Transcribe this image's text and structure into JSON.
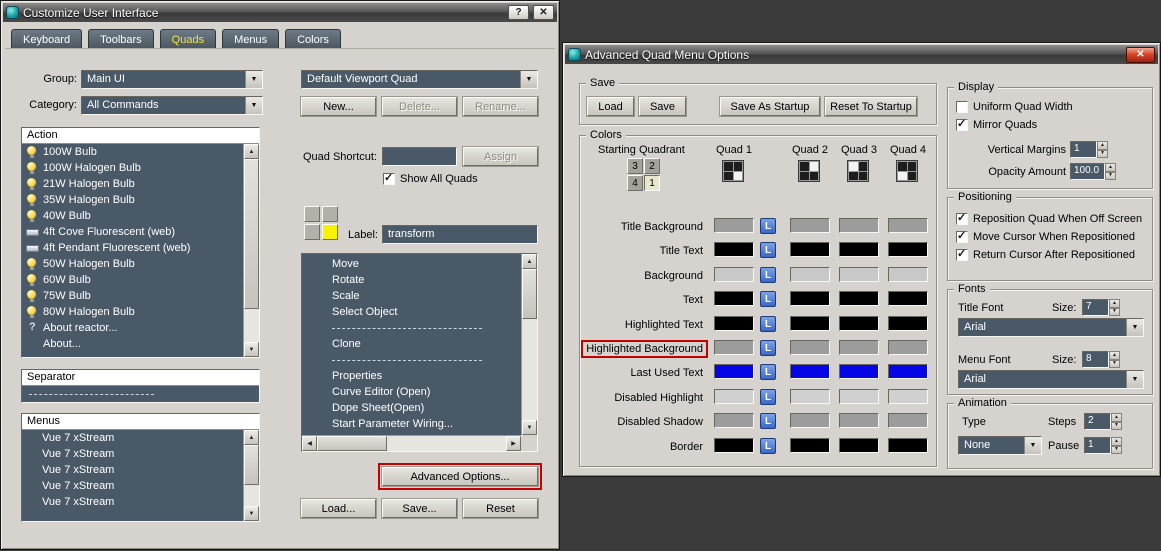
{
  "icons": {
    "help": "?",
    "close": "✕",
    "check": "✓",
    "up_arrow": "▲",
    "down_arrow": "▼",
    "left_arrow": "◀",
    "right_arrow": "▶"
  },
  "customize_window": {
    "title": "Customize User Interface",
    "tabs": [
      {
        "label": "Keyboard",
        "active": false
      },
      {
        "label": "Toolbars",
        "active": false
      },
      {
        "label": "Quads",
        "active": true
      },
      {
        "label": "Menus",
        "active": false
      },
      {
        "label": "Colors",
        "active": false
      }
    ],
    "group": {
      "label": "Group:",
      "value": "Main UI"
    },
    "category": {
      "label": "Category:",
      "value": "All Commands"
    },
    "action_list": {
      "header": "Action",
      "items": [
        {
          "label": "100W Bulb",
          "icon": "bulb"
        },
        {
          "label": "100W Halogen Bulb",
          "icon": "bulb"
        },
        {
          "label": "21W Halogen Bulb",
          "icon": "bulb"
        },
        {
          "label": "35W Halogen Bulb",
          "icon": "bulb"
        },
        {
          "label": "40W Bulb",
          "icon": "bulb"
        },
        {
          "label": "4ft Cove Fluorescent (web)",
          "icon": "fluorescent"
        },
        {
          "label": "4ft Pendant Fluorescent (web)",
          "icon": "fluorescent"
        },
        {
          "label": "50W Halogen Bulb",
          "icon": "bulb"
        },
        {
          "label": "60W Bulb",
          "icon": "bulb"
        },
        {
          "label": "75W Bulb",
          "icon": "bulb"
        },
        {
          "label": "80W Halogen Bulb",
          "icon": "bulb"
        },
        {
          "label": "About reactor...",
          "icon": "question"
        },
        {
          "label": "About...",
          "icon": "none"
        }
      ]
    },
    "separator_list": {
      "header": "Separator"
    },
    "menus_list": {
      "header": "Menus",
      "items": [
        "Vue 7 xStream",
        "Vue 7 xStream",
        "Vue 7 xStream",
        "Vue 7 xStream",
        "Vue 7 xStream"
      ]
    },
    "viewport_quad_select": {
      "value": "Default Viewport Quad"
    },
    "new_button": "New...",
    "delete_button": "Delete...",
    "rename_button": "Rename...",
    "quad_shortcut_label": "Quad Shortcut:",
    "quad_shortcut_value": "",
    "assign_button": "Assign",
    "show_all_quads": {
      "label": "Show All Quads",
      "checked": true
    },
    "quad_cells": [
      false,
      false,
      false,
      true
    ],
    "label_field": {
      "label": "Label:",
      "value": "transform"
    },
    "quad_menu_items": [
      {
        "label": "Move",
        "type": "item"
      },
      {
        "label": "Rotate",
        "type": "item"
      },
      {
        "label": "Scale",
        "type": "item"
      },
      {
        "label": "Select Object",
        "type": "item"
      },
      {
        "label": "",
        "type": "separator"
      },
      {
        "label": "Clone",
        "type": "item"
      },
      {
        "label": "",
        "type": "separator"
      },
      {
        "label": "Properties",
        "type": "item"
      },
      {
        "label": "Curve Editor (Open)",
        "type": "item"
      },
      {
        "label": "Dope Sheet(Open)",
        "type": "item"
      },
      {
        "label": "Start Parameter Wiring...",
        "type": "item"
      }
    ],
    "advanced_options_button": "Advanced Options...",
    "load_button": "Load...",
    "save_button": "Save...",
    "reset_button": "Reset"
  },
  "advanced_dialog": {
    "title": "Advanced Quad Menu Options",
    "save_group": {
      "label": "Save",
      "load": "Load",
      "save": "Save",
      "save_as_startup": "Save As Startup",
      "reset_to_startup": "Reset To Startup"
    },
    "colors_group": {
      "label": "Colors",
      "starting_quadrant_label": "Starting Quadrant",
      "quadrant_cells": [
        {
          "label": "3",
          "active": false
        },
        {
          "label": "2",
          "active": false
        },
        {
          "label": "4",
          "active": false
        },
        {
          "label": "1",
          "active": true
        }
      ],
      "quad_columns": [
        "Quad 1",
        "Quad 2",
        "Quad 3",
        "Quad 4"
      ],
      "lock_button": "L",
      "rows": [
        {
          "label": "Title Background",
          "color": "#9c9c9c",
          "highlighted": false
        },
        {
          "label": "Title Text",
          "color": "#000000",
          "highlighted": false
        },
        {
          "label": "Background",
          "color": "#c8c8c8",
          "highlighted": false
        },
        {
          "label": "Text",
          "color": "#000000",
          "highlighted": false
        },
        {
          "label": "Highlighted Text",
          "color": "#000000",
          "highlighted": false
        },
        {
          "label": "Highlighted Background",
          "color": "#9c9c9c",
          "highlighted": true
        },
        {
          "label": "Last Used Text",
          "color": "#0505e6",
          "highlighted": false
        },
        {
          "label": "Disabled Highlight",
          "color": "#d0d0d0",
          "highlighted": false
        },
        {
          "label": "Disabled Shadow",
          "color": "#9c9c9c",
          "highlighted": false
        },
        {
          "label": "Border",
          "color": "#000000",
          "highlighted": false
        }
      ]
    },
    "display_group": {
      "label": "Display",
      "uniform_quad_width": {
        "label": "Uniform Quad Width",
        "checked": false
      },
      "mirror_quads": {
        "label": "Mirror Quads",
        "checked": true
      },
      "vertical_margins": {
        "label": "Vertical Margins",
        "value": "1"
      },
      "opacity_amount": {
        "label": "Opacity Amount",
        "value": "100.0"
      }
    },
    "positioning_group": {
      "label": "Positioning",
      "checkboxes": [
        {
          "label": "Reposition Quad When Off Screen",
          "checked": true
        },
        {
          "label": "Move Cursor When Repositioned",
          "checked": true
        },
        {
          "label": "Return Cursor After Repositioned",
          "checked": true
        }
      ]
    },
    "fonts_group": {
      "label": "Fonts",
      "title_font_label": "Title Font",
      "title_size_label": "Size:",
      "title_size_value": "7",
      "title_font_value": "Arial",
      "menu_font_label": "Menu Font",
      "menu_size_label": "Size:",
      "menu_size_value": "8",
      "menu_font_value": "Arial"
    },
    "animation_group": {
      "label": "Animation",
      "type_label": "Type",
      "steps_label": "Steps",
      "steps_value": "2",
      "type_value": "None",
      "pause_label": "Pause",
      "pause_value": "1"
    }
  }
}
